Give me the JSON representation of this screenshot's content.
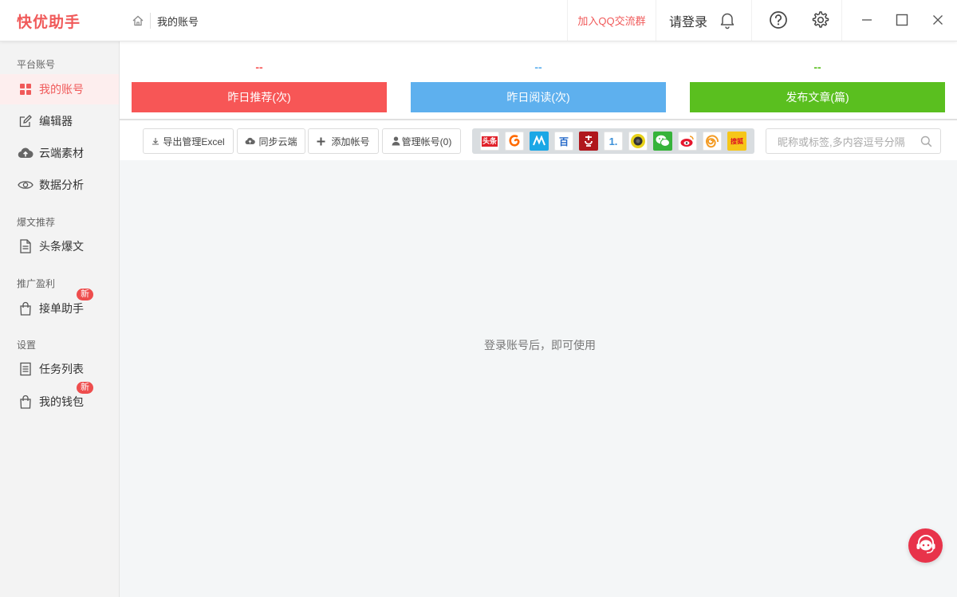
{
  "app": {
    "logo": "快优助手",
    "colors": {
      "accent": "#f05a5a",
      "red": "#f75656",
      "blue": "#5eb0ee",
      "green": "#5abf1f"
    }
  },
  "header": {
    "breadcrumb": {
      "icon": "home-icon",
      "label": "我的账号"
    },
    "qq_group_link": "加入QQ交流群",
    "login_label": "请登录",
    "icons": [
      "bell-icon",
      "help-icon",
      "settings-icon",
      "minimize-icon",
      "maximize-icon",
      "close-icon"
    ]
  },
  "sidebar": {
    "sections": [
      {
        "title": "平台账号",
        "items": [
          {
            "label": "我的账号",
            "icon": "grid-icon",
            "active": true
          },
          {
            "label": "编辑器",
            "icon": "edit-icon"
          },
          {
            "label": "云端素材",
            "icon": "cloud-icon"
          },
          {
            "label": "数据分析",
            "icon": "eye-icon"
          }
        ]
      },
      {
        "title": "爆文推荐",
        "items": [
          {
            "label": "头条爆文",
            "icon": "document-icon"
          }
        ]
      },
      {
        "title": "推广盈利",
        "items": [
          {
            "label": "接单助手",
            "icon": "bag-icon",
            "badge": "新"
          }
        ]
      },
      {
        "title": "设置",
        "items": [
          {
            "label": "任务列表",
            "icon": "list-icon"
          },
          {
            "label": "我的钱包",
            "icon": "wallet-icon",
            "badge": "新"
          }
        ]
      }
    ]
  },
  "stats": [
    {
      "value": "--",
      "label": "昨日推荐(次)",
      "color": "#f75656"
    },
    {
      "value": "--",
      "label": "昨日阅读(次)",
      "color": "#5eb0ee"
    },
    {
      "value": "--",
      "label": "发布文章(篇)",
      "color": "#5abf1f"
    }
  ],
  "toolbar": {
    "buttons": [
      {
        "label": "导出管理Excel",
        "icon": "download-icon"
      },
      {
        "label": "同步云端",
        "icon": "cloud-upload-icon"
      },
      {
        "label": "添加帐号",
        "icon": "plus-icon"
      },
      {
        "label": "管理帐号(0)",
        "icon": "user-icon"
      }
    ],
    "platforms": [
      {
        "name": "toutiao-icon",
        "text": "头条",
        "color": "#e0212a"
      },
      {
        "name": "platform-swirl-icon",
        "text": "",
        "color": "#ff6a00"
      },
      {
        "name": "platform-m-icon",
        "text": "",
        "color": "#1ba7e6"
      },
      {
        "name": "baijiahao-icon",
        "text": "百",
        "color": "#2468c8"
      },
      {
        "name": "platform-seal-icon",
        "text": "",
        "color": "#b0171c"
      },
      {
        "name": "yidian-icon",
        "text": "1.",
        "color": "#3a8fd8"
      },
      {
        "name": "platform-circle-icon",
        "text": "",
        "color": "#e8d21a"
      },
      {
        "name": "wechat-icon",
        "text": "",
        "color": "#36b33a"
      },
      {
        "name": "weibo-icon",
        "text": "",
        "color": "#e6162d"
      },
      {
        "name": "platform-spiral-icon",
        "text": "",
        "color": "#f39c26"
      },
      {
        "name": "sohu-icon",
        "text": "搜狐",
        "color": "#f6c619"
      }
    ],
    "search": {
      "placeholder": "昵称或标签,多内容逗号分隔"
    }
  },
  "content": {
    "empty_message": "登录账号后，即可使用"
  }
}
